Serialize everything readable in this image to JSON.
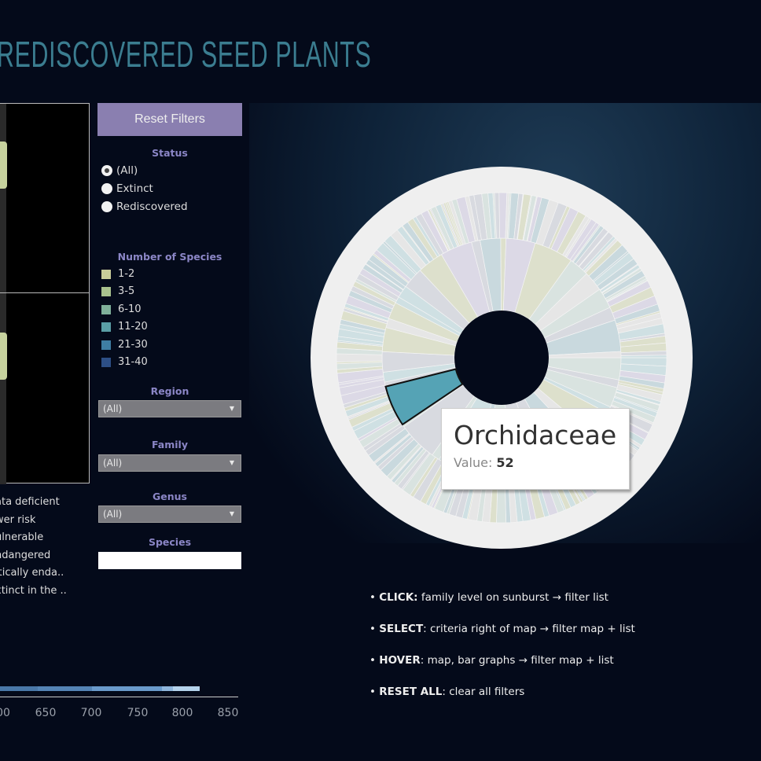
{
  "title": "REDISCOVERED SEED PLANTS",
  "filters": {
    "reset_label": "Reset Filters",
    "status": {
      "label": "Status",
      "options": [
        "(All)",
        "Extinct",
        "Rediscovered"
      ],
      "selected": "(All)"
    },
    "legend": {
      "label": "Number of Species",
      "items": [
        {
          "label": "1-2",
          "color": "#c9cc9a"
        },
        {
          "label": "3-5",
          "color": "#a9c28e"
        },
        {
          "label": "6-10",
          "color": "#7fb09a"
        },
        {
          "label": "11-20",
          "color": "#5a9ea6"
        },
        {
          "label": "21-30",
          "color": "#3f7ea3"
        },
        {
          "label": "31-40",
          "color": "#2d4f86"
        }
      ]
    },
    "region": {
      "label": "Region",
      "value": "(All)"
    },
    "family": {
      "label": "Family",
      "value": "(All)"
    },
    "genus": {
      "label": "Genus",
      "value": "(All)"
    },
    "species": {
      "label": "Species",
      "value": ""
    }
  },
  "iucn_legend": [
    "ata deficient",
    "wer risk",
    "ulnerable",
    "ndangered",
    "itically enda..",
    "xtinct in the .."
  ],
  "axis_ticks": [
    "00",
    "650",
    "700",
    "750",
    "800",
    "850"
  ],
  "tooltip": {
    "name": "Orchidaceae",
    "value_label": "Value:",
    "value": "52"
  },
  "instructions": [
    {
      "key": "CLICK:",
      "text": " family level on sunburst → filter list"
    },
    {
      "key": "SELECT",
      "text": ": criteria right of map → filter map + list"
    },
    {
      "key": "HOVER",
      "text": ": map, bar graphs → filter map + list"
    },
    {
      "key": "RESET ALL",
      "text": ": clear all filters"
    }
  ],
  "colors": {
    "background": "#040a1a",
    "title": "#3b7d90",
    "accent": "#8a7fb0",
    "highlight": "#55a3b5"
  }
}
